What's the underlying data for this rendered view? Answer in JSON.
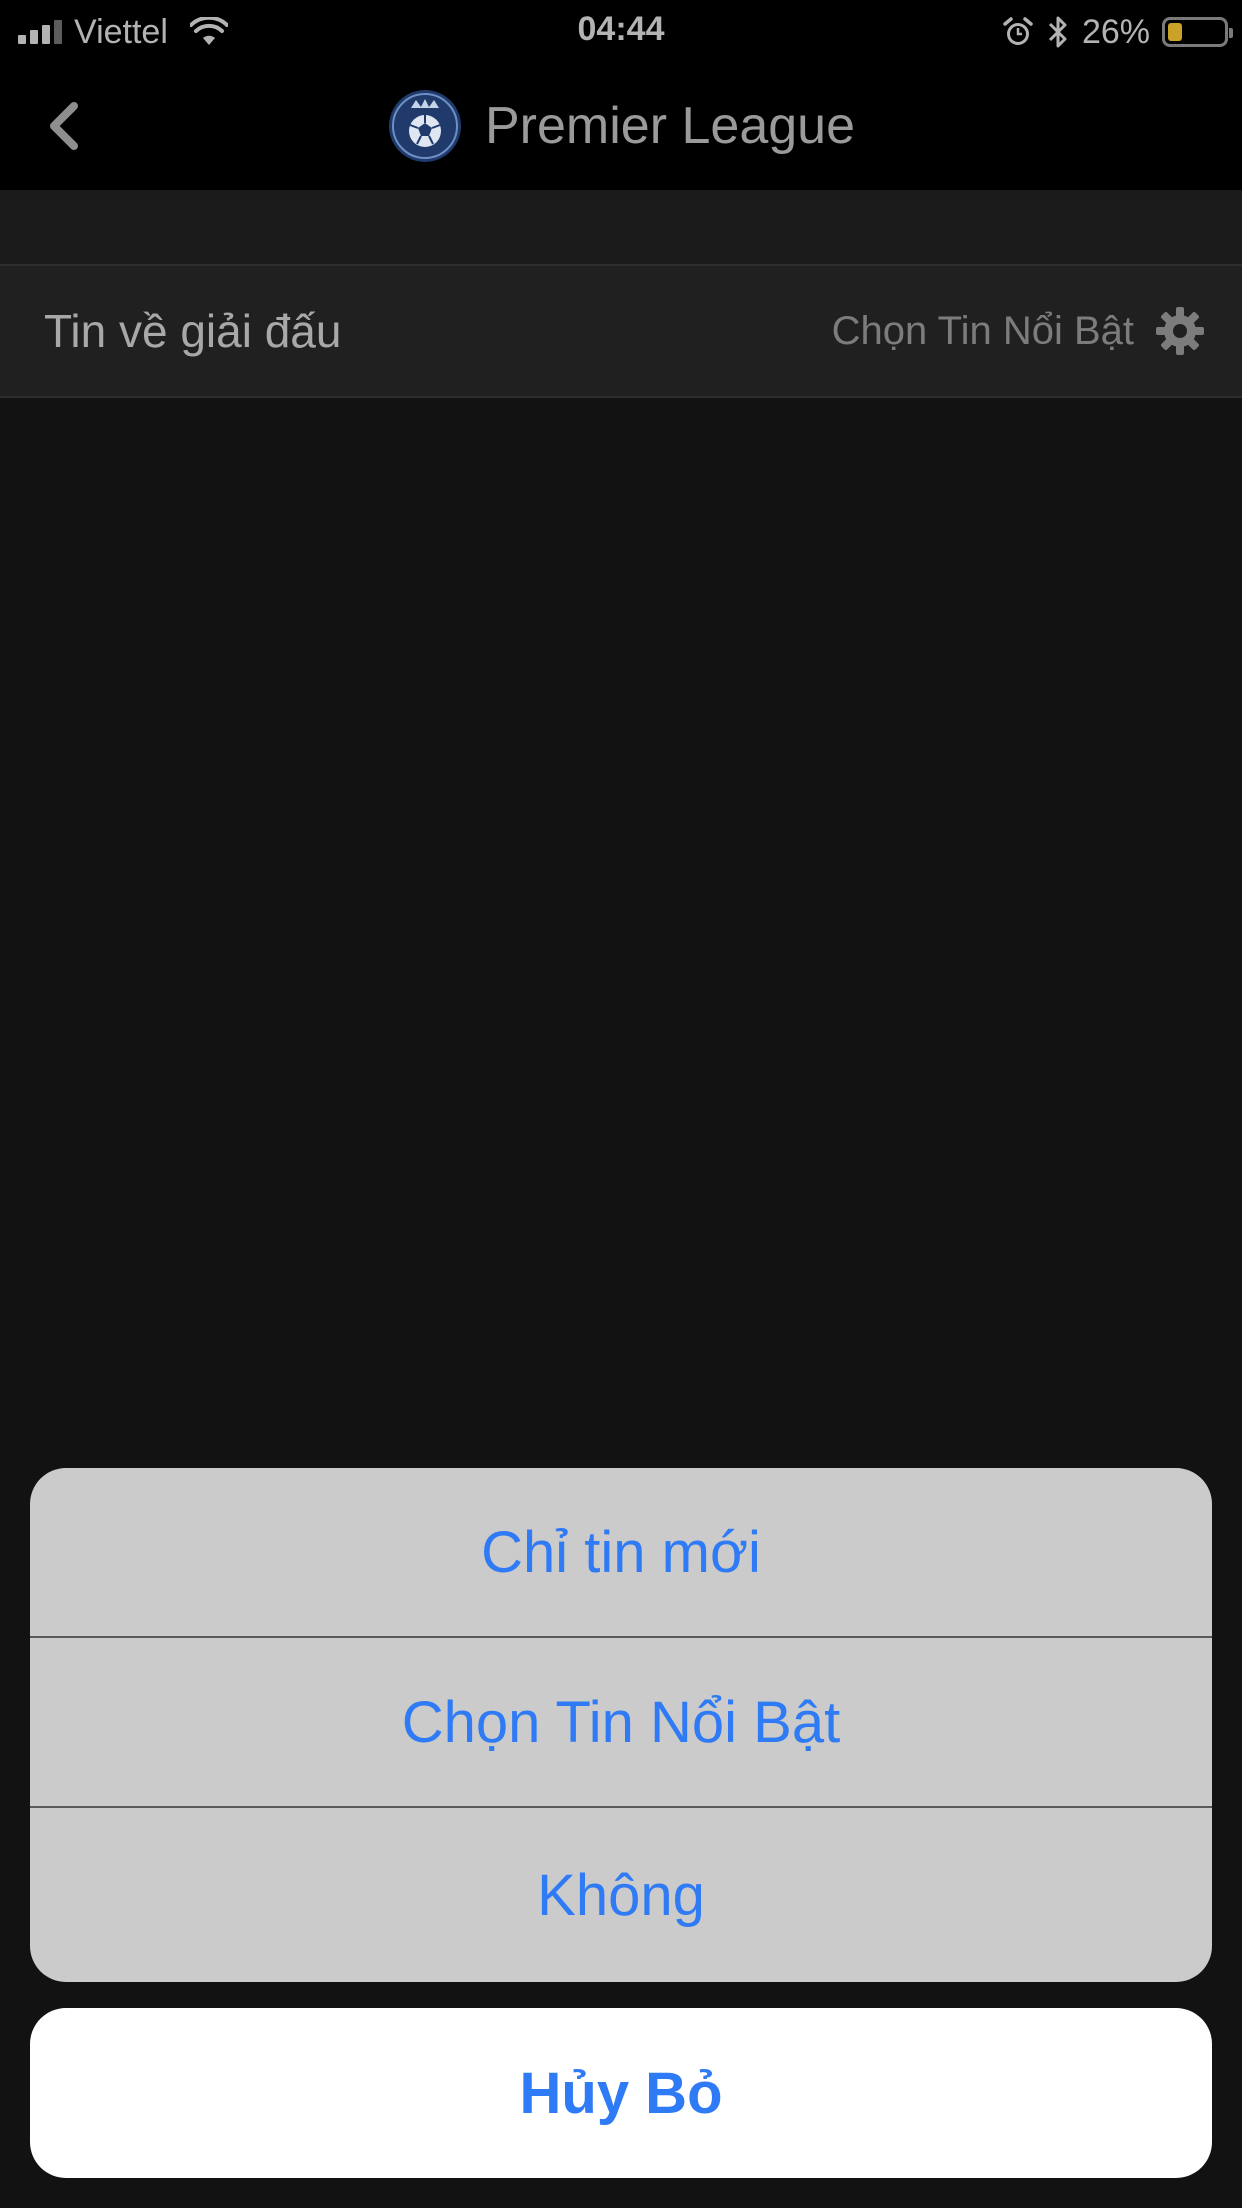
{
  "status_bar": {
    "carrier": "Viettel",
    "time": "04:44",
    "battery_percent": "26%",
    "battery_level": 0.26,
    "icons": [
      "signal-icon",
      "wifi-icon",
      "alarm-icon",
      "bluetooth-icon",
      "battery-icon"
    ]
  },
  "nav": {
    "title": "Premier League",
    "back_icon": "chevron-left-icon",
    "logo_icon": "league-logo-icon"
  },
  "section": {
    "title": "Tin về giải đấu",
    "action_label": "Chọn Tin Nổi Bật",
    "action_icon": "gear-icon"
  },
  "action_sheet": {
    "options": [
      {
        "label": "Chỉ tin mới"
      },
      {
        "label": "Chọn Tin Nổi Bật"
      },
      {
        "label": "Không"
      }
    ],
    "cancel_label": "Hủy Bỏ"
  },
  "colors": {
    "accent": "#2f7af5",
    "background": "#121212",
    "sheet_background": "#cbcbcb",
    "battery_fill": "#c9a227"
  }
}
